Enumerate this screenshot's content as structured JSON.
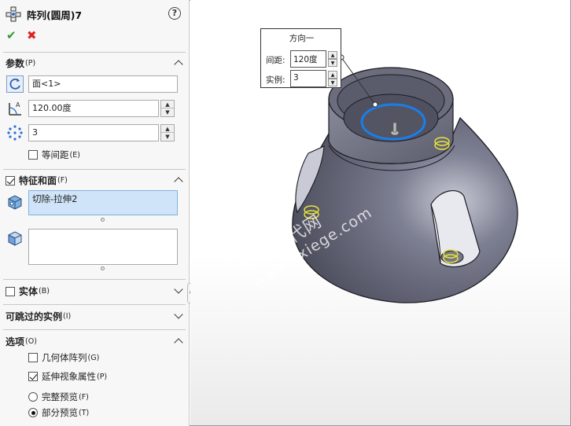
{
  "panel": {
    "title": "阵列(圆周)7",
    "help": "?",
    "ok_icon": "check-icon",
    "cancel_icon": "x-icon"
  },
  "params": {
    "section_label": "参数",
    "section_hotkey": "(P)",
    "axis_value": "面<1>",
    "angle_value": "120.00度",
    "count_value": "3",
    "equal_spacing_label": "等间距",
    "equal_spacing_hotkey": "(E)",
    "equal_spacing_checked": false
  },
  "features": {
    "section_label": "特征和面",
    "section_hotkey": "(F)",
    "checked": true,
    "items": [
      "切除-拉伸2"
    ],
    "faces_items": []
  },
  "bodies": {
    "section_label": "实体",
    "section_hotkey": "(B)",
    "checked": false
  },
  "skip": {
    "section_label": "可跳过的实例",
    "section_hotkey": "(I)"
  },
  "options": {
    "section_label": "选项",
    "section_hotkey": "(O)",
    "geom_pattern_label": "几何体阵列",
    "geom_pattern_hotkey": "(G)",
    "geom_pattern_checked": false,
    "propagate_label": "延伸视象属性",
    "propagate_hotkey": "(P)",
    "propagate_checked": true,
    "full_preview_label": "完整预览",
    "full_preview_hotkey": "(F)",
    "partial_preview_label": "部分预览",
    "partial_preview_hotkey": "(T)",
    "selected_preview": "partial"
  },
  "callout": {
    "title": "方向一",
    "spacing_label": "间距:",
    "spacing_value": "120度",
    "instances_label": "实例:",
    "instances_value": "3"
  },
  "watermark": {
    "line1": "机械时代网",
    "line2": "www.jixiege.com"
  },
  "colors": {
    "model": "#5a5d6e",
    "highlight_edge": "#1a7ee8",
    "marker": "#e8e23a",
    "ok": "#2e9a2e",
    "cancel": "#dd2222"
  }
}
